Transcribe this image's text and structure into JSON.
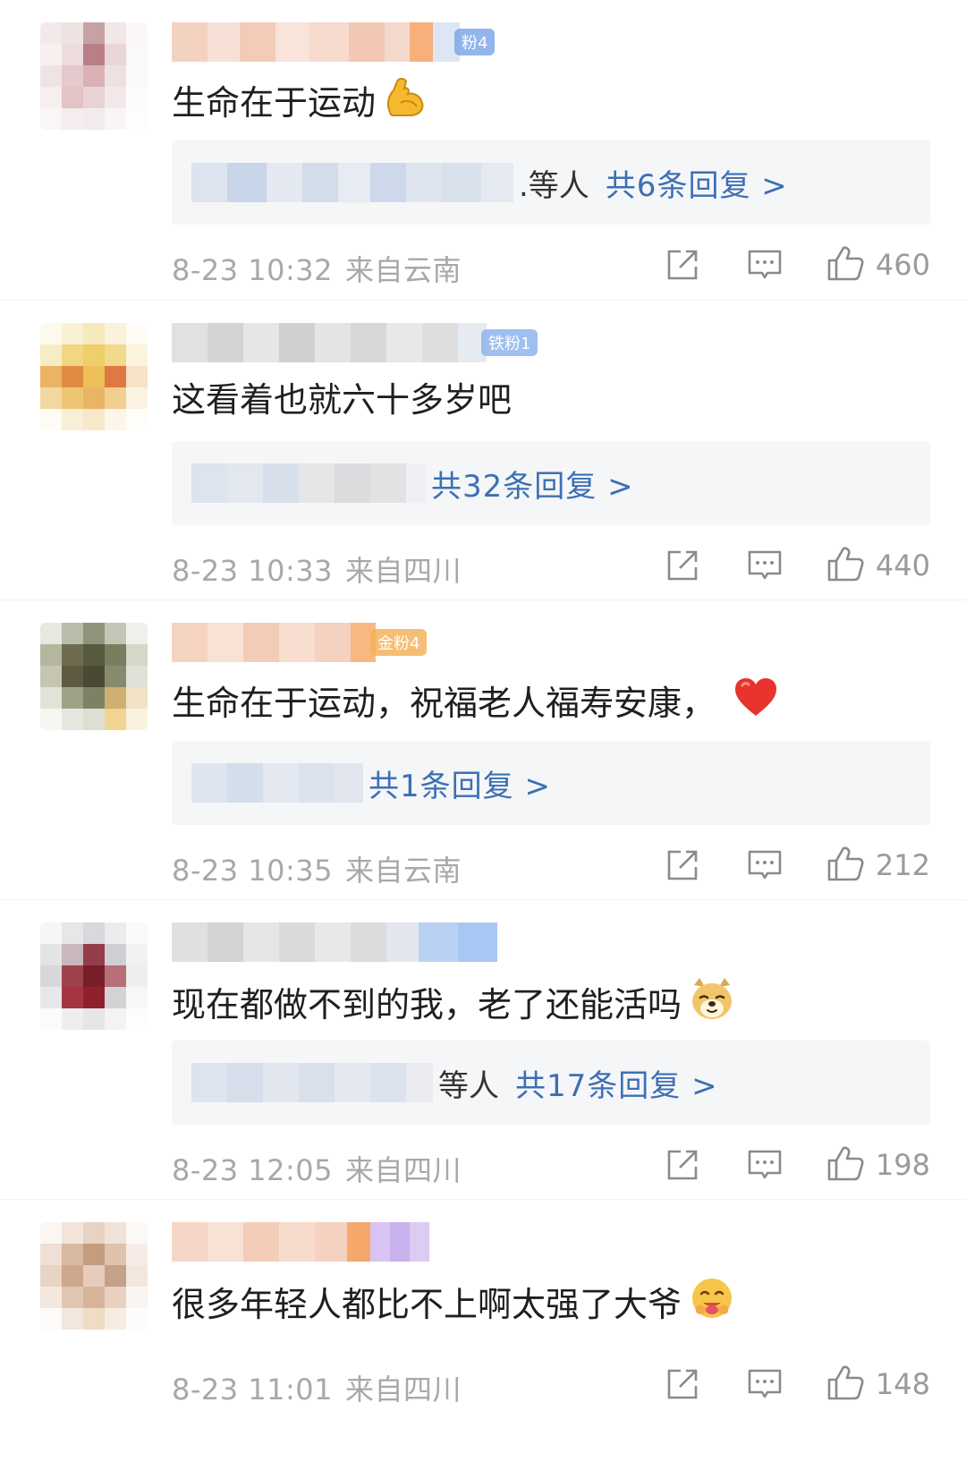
{
  "comments": [
    {
      "fan_badge": "粉4",
      "badge_color": "#7fa9e8",
      "text": "生命在于运动",
      "emoji": "flexed-biceps-icon",
      "reply_suffix": ".等人",
      "reply_count_label": "共6条回复 >",
      "date": "8-23 10:32",
      "location": "来自云南",
      "likes": "460"
    },
    {
      "fan_badge": "铁粉1",
      "badge_color": "#8fb4ee",
      "text": "这看着也就六十多岁吧",
      "emoji": "",
      "reply_suffix": "",
      "reply_count_label": "共32条回复 >",
      "date": "8-23 10:33",
      "location": "来自四川",
      "likes": "440"
    },
    {
      "fan_badge": "金粉4",
      "badge_color": "#f3b35e",
      "text": "生命在于运动，祝福老人福寿安康，",
      "emoji": "red-heart-icon",
      "reply_suffix": "",
      "reply_count_label": "共1条回复 >",
      "date": "8-23 10:35",
      "location": "来自云南",
      "likes": "212"
    },
    {
      "fan_badge": "",
      "badge_color": "#8fb4ee",
      "text": "现在都做不到的我，老了还能活吗",
      "emoji": "doge-icon",
      "reply_suffix": "等人",
      "reply_count_label": "共17条回复 >",
      "date": "8-23 12:05",
      "location": "来自四川",
      "likes": "198"
    },
    {
      "fan_badge": "",
      "badge_color": "#c9b2ee",
      "text": "很多年轻人都比不上啊太强了大爷",
      "emoji": "hugging-face-icon",
      "reply_suffix": "",
      "reply_count_label": "",
      "date": "8-23 11:01",
      "location": "来自四川",
      "likes": "148"
    }
  ],
  "colors": {
    "reply_link": "#3d6fb5",
    "meta_text": "#a8a8a8",
    "reply_bg": "#f5f6f8"
  }
}
